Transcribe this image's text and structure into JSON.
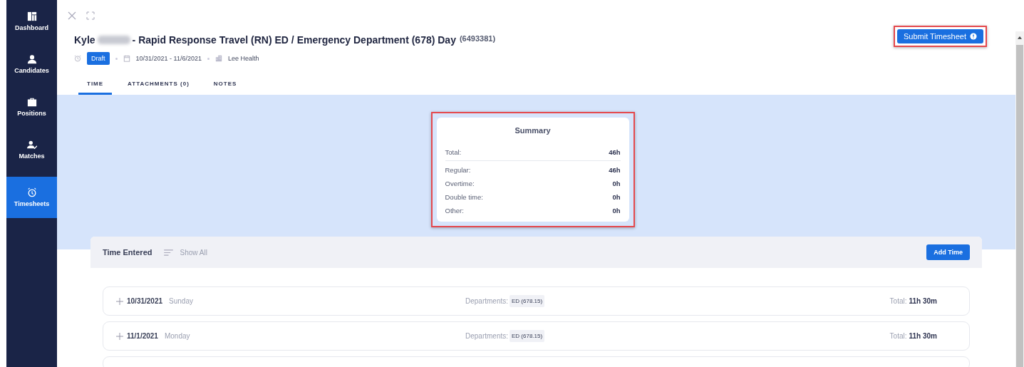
{
  "sidebar": {
    "items": [
      {
        "label": "Dashboard",
        "selected": false
      },
      {
        "label": "Candidates",
        "selected": false
      },
      {
        "label": "Positions",
        "selected": false
      },
      {
        "label": "Matches",
        "selected": false
      },
      {
        "label": "Timesheets",
        "selected": true
      }
    ]
  },
  "header": {
    "title_first": "Kyle",
    "title_rest": "- Rapid Response Travel (RN) ED / Emergency Department (678) Day",
    "title_id": "(6493381)",
    "status": "Draft",
    "dates": "10/31/2021 - 11/6/2021",
    "facility": "Lee Health",
    "submit_button": "Submit Timesheet",
    "submit_highlighted": true
  },
  "tabs": [
    {
      "label": "TIME",
      "selected": true
    },
    {
      "label": "ATTACHMENTS (0)",
      "selected": false
    },
    {
      "label": "NOTES",
      "selected": false
    }
  ],
  "summary": {
    "title": "Summary",
    "highlighted": true,
    "rows": [
      {
        "label": "Total:",
        "value": "46h"
      },
      {
        "label": "Regular:",
        "value": "46h"
      },
      {
        "label": "Overtime:",
        "value": "0h"
      },
      {
        "label": "Double time:",
        "value": "0h"
      },
      {
        "label": "Other:",
        "value": "0h"
      }
    ]
  },
  "time_entered": {
    "title": "Time Entered",
    "filter": "Show All",
    "add_button": "Add Time",
    "days": [
      {
        "date": "10/31/2021",
        "weekday": "Sunday",
        "departments_label": "Departments:",
        "department": "ED (678.15)",
        "total_label": "Total:",
        "total": "11h 30m"
      },
      {
        "date": "11/1/2021",
        "weekday": "Monday",
        "departments_label": "Departments:",
        "department": "ED (678.15)",
        "total_label": "Total:",
        "total": "11h 30m"
      }
    ]
  }
}
